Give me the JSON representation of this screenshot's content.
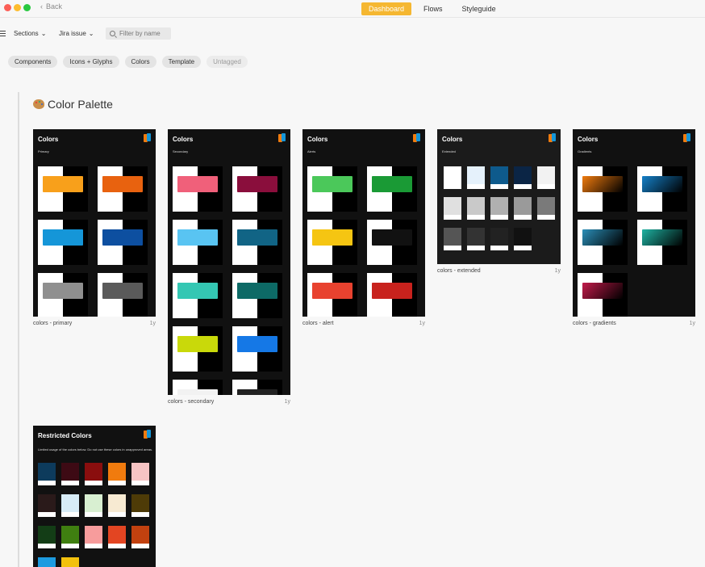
{
  "window": {
    "back_label": "Back",
    "tabs": [
      {
        "label": "Dashboard",
        "active": true
      },
      {
        "label": "Flows",
        "active": false
      },
      {
        "label": "Styleguide",
        "active": false
      }
    ]
  },
  "toolbar": {
    "sections_label": "Sections",
    "jira_label": "Jira issue",
    "filter_placeholder": "Filter by name"
  },
  "chips": [
    {
      "label": "Components"
    },
    {
      "label": "Icons + Glyphs"
    },
    {
      "label": "Colors"
    },
    {
      "label": "Template"
    },
    {
      "label": "Untagged",
      "muted": true
    }
  ],
  "section": {
    "title": "Color Palette",
    "icon": "palette-icon"
  },
  "cards": [
    {
      "name": "colors - primary",
      "age": "1y",
      "thumb_title": "Colors",
      "thumb_sub": "Primary",
      "swatches": [
        "#f8a01b",
        "#e8620f",
        "#1596d8",
        "#0d4fa0",
        "#8f8f8f",
        "#5a5a5a"
      ]
    },
    {
      "name": "colors - secondary",
      "age": "1y",
      "thumb_title": "Colors",
      "thumb_sub": "Secondary",
      "swatches": [
        "#f0607a",
        "#8a0e3c",
        "#59c4f2",
        "#116485",
        "#34c7b3",
        "#0d6a66",
        "#c9d90a",
        "#1578e6",
        "#f2f2f2",
        "#222"
      ]
    },
    {
      "name": "colors - alert",
      "age": "1y",
      "thumb_title": "Colors",
      "thumb_sub": "Alerts",
      "swatches": [
        "#4bc85a",
        "#1a9a35",
        "#f5c512",
        "#111111",
        "#e8422f",
        "#c8221d"
      ]
    },
    {
      "name": "colors - extended",
      "age": "1y",
      "thumb_title": "Colors",
      "thumb_sub": "Extended",
      "swatches": [
        "#ffffff",
        "#e5f1fb",
        "#0e5a8c",
        "#0b2545",
        "#f2f2f2",
        "#e0e0e0",
        "#c9c9c9",
        "#b0b0b0",
        "#9a9a9a",
        "#7a7a7a",
        "#555555",
        "#333333",
        "#222222",
        "#111111"
      ]
    },
    {
      "name": "colors - gradients",
      "age": "1y",
      "thumb_title": "Colors",
      "thumb_sub": "Gradients",
      "swatches": [
        "#f07b0e",
        "#1580c8",
        "#2b8fb8",
        "#1fb3a3",
        "#c21a4a"
      ]
    },
    {
      "name": "",
      "age": "",
      "thumb_title": "Restricted Colors",
      "thumb_sub": "Limited usage of the colors below. Do not use these colors in unapproved areas.",
      "swatches": [
        "#0d3b5c",
        "#3d0a14",
        "#8a0e0e",
        "#f07b0e",
        "#f7c4c4",
        "#2a1a1a",
        "#d7ecf7",
        "#d8efd1",
        "#f7ead2",
        "#4e3b07",
        "#133d16",
        "#3f7f10",
        "#f79c9c",
        "#e34522",
        "#c2410f",
        "#1d9be0",
        "#f2c10d"
      ]
    }
  ]
}
